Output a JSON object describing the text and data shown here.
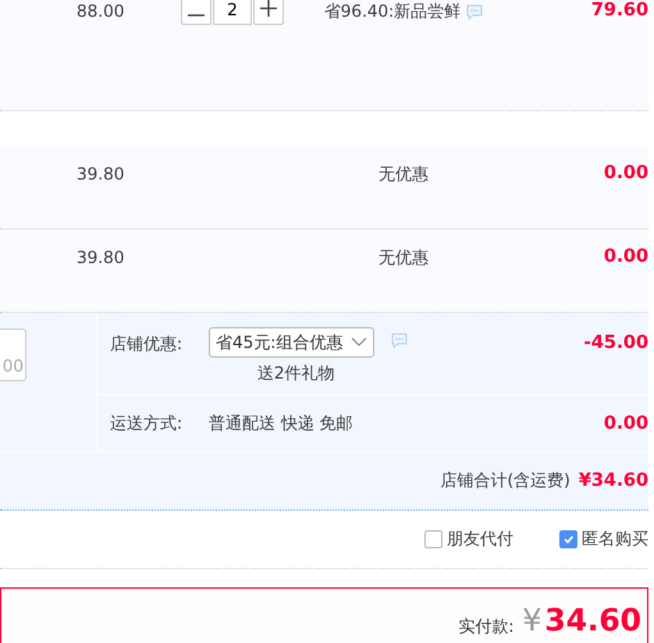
{
  "items": [
    {
      "price": "88.00",
      "quantity": "2",
      "promo": "省96.40:新品尝鲜",
      "has_note": true,
      "subtotal": "79.60"
    },
    {
      "price": "39.80",
      "promo": "无优惠",
      "has_note": false,
      "subtotal": "0.00"
    },
    {
      "price": "39.80",
      "promo": "无优惠",
      "has_note": false,
      "subtotal": "0.00"
    }
  ],
  "store": {
    "memo": {
      "value": "00"
    },
    "discount": {
      "label": "店铺优惠:",
      "choice": "省45元:组合优惠",
      "gift": "送2件礼物",
      "has_note": true,
      "amount": "-45.00"
    },
    "shipping": {
      "label": "运送方式:",
      "method": "普通配送 快递 免邮",
      "amount": "0.00"
    },
    "total": {
      "label": "店铺合计(含运费)",
      "amount": "¥34.60"
    }
  },
  "options": [
    {
      "label": "朋友代付",
      "checked": false
    },
    {
      "label": "匿名购买",
      "checked": true
    }
  ],
  "payment": {
    "label": "实付款:",
    "currency": "¥",
    "amount": "34.60"
  }
}
